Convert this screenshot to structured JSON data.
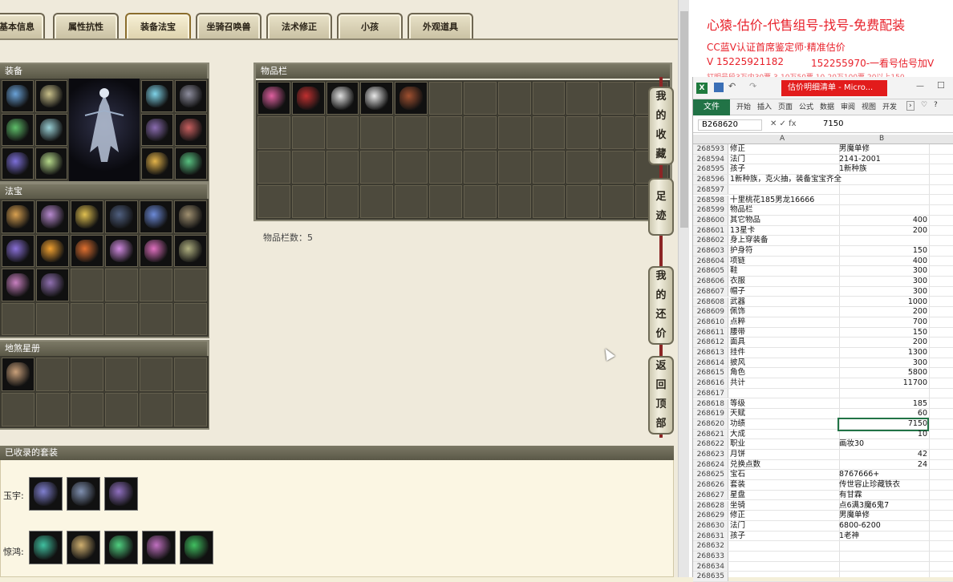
{
  "tabs": [
    {
      "label": "基本信息",
      "active": false
    },
    {
      "label": "属性抗性",
      "active": false
    },
    {
      "label": "装备法宝",
      "active": true
    },
    {
      "label": "坐骑召唤兽",
      "active": false
    },
    {
      "label": "法术修正",
      "active": false
    },
    {
      "label": "小孩",
      "active": false
    },
    {
      "label": "外观道具",
      "active": false
    }
  ],
  "panels": {
    "equipment_title": "装备",
    "fabao_title": "法宝",
    "xingce_title": "地煞星册",
    "inventory_title": "物品栏",
    "inventory_count": "物品栏数：5"
  },
  "side_buttons": [
    {
      "label": "我的收藏"
    },
    {
      "label": "足迹"
    },
    {
      "label": "我的还价"
    },
    {
      "label": "返回顶部"
    }
  ],
  "sets": {
    "title": "已收录的套装",
    "rows": [
      {
        "label": "玉宇:",
        "count": 3
      },
      {
        "label": "惊鸿:",
        "count": 5
      }
    ]
  },
  "icon_colors": {
    "equip_left": [
      "#6aa2d8",
      "#c9c08a",
      "#5fbf6a",
      "#9ad0d6",
      "#7c6fd8",
      "#b5d88a"
    ],
    "equip_right": [
      "#7fd3e8",
      "#8e8e9e",
      "#8a6cb0",
      "#c96060",
      "#e3b34a",
      "#58c080"
    ],
    "fabao": [
      "#d8a050",
      "#b88ad0",
      "#e0c050",
      "#506080",
      "#6c8ad8",
      "#a09070",
      "#8a70d8",
      "#f0a030",
      "#e07030",
      "#d08ae0",
      "#e070c0",
      "#b0b080",
      "#c880c0",
      "#9070b0"
    ],
    "inventory": [
      "#e060a0",
      "#c03030",
      "#e0e0e0",
      "#e8e8e8",
      "#a05030"
    ],
    "set1": [
      "#8080d0",
      "#8090b0",
      "#9070c0"
    ],
    "set2": [
      "#40c0a0",
      "#d0b070",
      "#50d080",
      "#c070c0",
      "#40c060"
    ]
  },
  "overlay": {
    "headline": "心猿-估价-代售组号-找号-免费配装",
    "line2": "CC蓝V认证首席鉴定师·精准估价",
    "line3": "V 15225921182",
    "line3b": "152255970-一看号估号加V",
    "line4": "打明号段3万内30票 3-10万50票 10-20万100票 20以上150"
  },
  "excel": {
    "window_title": "估价明细清单 - Micro...",
    "file_tab": "文件",
    "ribbon_tabs": [
      "开始",
      "插入",
      "页面",
      "公式",
      "数据",
      "审阅",
      "视图",
      "开发"
    ],
    "name_box": "B268620",
    "formula_value": "7150",
    "col_a": "A",
    "col_b": "B",
    "rows": [
      {
        "n": "268593",
        "a": "修正",
        "b": "男魔单修",
        "num": false
      },
      {
        "n": "268594",
        "a": "法门",
        "b": "2141-2001",
        "num": false
      },
      {
        "n": "268595",
        "a": "孩子",
        "b": "1新种族",
        "num": false
      },
      {
        "n": "268596",
        "a": "1新种族，克火抽，装备宝宝齐全",
        "b": "",
        "num": false
      },
      {
        "n": "268597",
        "a": "",
        "b": "",
        "num": false
      },
      {
        "n": "268598",
        "a": "十里桃花185男龙16666",
        "b": "",
        "num": false
      },
      {
        "n": "268599",
        "a": "物品栏",
        "b": "",
        "num": false
      },
      {
        "n": "268600",
        "a": "其它物品",
        "b": "400",
        "num": true
      },
      {
        "n": "268601",
        "a": "13星卡",
        "b": "200",
        "num": true
      },
      {
        "n": "268602",
        "a": "身上穿装备",
        "b": "",
        "num": false
      },
      {
        "n": "268603",
        "a": "护身符",
        "b": "150",
        "num": true
      },
      {
        "n": "268604",
        "a": "项链",
        "b": "400",
        "num": true
      },
      {
        "n": "268605",
        "a": "鞋",
        "b": "300",
        "num": true
      },
      {
        "n": "268606",
        "a": "衣服",
        "b": "300",
        "num": true
      },
      {
        "n": "268607",
        "a": "帽子",
        "b": "300",
        "num": true
      },
      {
        "n": "268608",
        "a": "武器",
        "b": "1000",
        "num": true
      },
      {
        "n": "268609",
        "a": "佩饰",
        "b": "200",
        "num": true
      },
      {
        "n": "268610",
        "a": "点粹",
        "b": "700",
        "num": true
      },
      {
        "n": "268611",
        "a": "腰带",
        "b": "150",
        "num": true
      },
      {
        "n": "268612",
        "a": "面具",
        "b": "200",
        "num": true
      },
      {
        "n": "268613",
        "a": "挂件",
        "b": "1300",
        "num": true
      },
      {
        "n": "268614",
        "a": "披风",
        "b": "300",
        "num": true
      },
      {
        "n": "268615",
        "a": "角色",
        "b": "5800",
        "num": true
      },
      {
        "n": "268616",
        "a": "共计",
        "b": "11700",
        "num": true
      },
      {
        "n": "268617",
        "a": "",
        "b": "",
        "num": false
      },
      {
        "n": "268618",
        "a": "等级",
        "b": "185",
        "num": true
      },
      {
        "n": "268619",
        "a": "天赋",
        "b": "60",
        "num": true
      },
      {
        "n": "268620",
        "a": "功绩",
        "b": "7150",
        "num": true
      },
      {
        "n": "268621",
        "a": "大成",
        "b": "10",
        "num": true
      },
      {
        "n": "268622",
        "a": "职业",
        "b": "画妆30",
        "num": false
      },
      {
        "n": "268623",
        "a": "月饼",
        "b": "42",
        "num": true
      },
      {
        "n": "268624",
        "a": "兑换点数",
        "b": "24",
        "num": true
      },
      {
        "n": "268625",
        "a": "宝石",
        "b": "8767666+",
        "num": false
      },
      {
        "n": "268626",
        "a": "套装",
        "b": "传世容止珍藏铁衣",
        "num": false
      },
      {
        "n": "268627",
        "a": "星盘",
        "b": "有甘霖",
        "num": false
      },
      {
        "n": "268628",
        "a": "坐骑",
        "b": "点6满3魔6鬼7",
        "num": false
      },
      {
        "n": "268629",
        "a": "修正",
        "b": "男魔单修",
        "num": false
      },
      {
        "n": "268630",
        "a": "法门",
        "b": "6800-6200",
        "num": false
      },
      {
        "n": "268631",
        "a": "孩子",
        "b": "1老神",
        "num": false
      },
      {
        "n": "268632",
        "a": "",
        "b": "",
        "num": false
      },
      {
        "n": "268633",
        "a": "",
        "b": "",
        "num": false
      },
      {
        "n": "268634",
        "a": "",
        "b": "",
        "num": false
      },
      {
        "n": "268635",
        "a": "",
        "b": "",
        "num": false
      }
    ]
  }
}
